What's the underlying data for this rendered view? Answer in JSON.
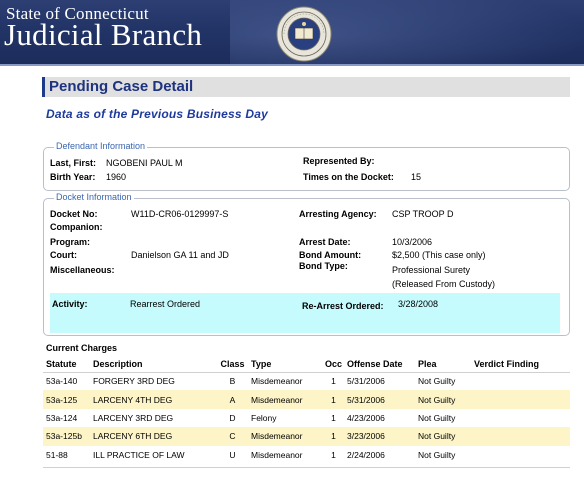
{
  "header": {
    "state": "State of Connecticut",
    "branch": "Judicial Branch",
    "seal_icon": "ct-judicial-seal-icon"
  },
  "page_title": "Pending Case Detail",
  "subtitle": "Data as of the Previous Business Day",
  "defendant": {
    "legend": "Defendant Information",
    "name_label": "Last, First:",
    "name_value": "NGOBENI PAUL M",
    "birth_label": "Birth Year:",
    "birth_value": "1960",
    "represented_label": "Represented By:",
    "represented_value": "",
    "times_label": "Times on the Docket:",
    "times_value": "15"
  },
  "docket": {
    "legend": "Docket Information",
    "docket_label": "Docket No:",
    "docket_value": "W11D-CR06-0129997-S",
    "companion_label": "Companion:",
    "program_label": "Program:",
    "court_label": "Court:",
    "court_value": "Danielson GA 11 and JD",
    "misc_label": "Miscellaneous:",
    "agency_label": "Arresting Agency:",
    "agency_value": "CSP TROOP D",
    "arrest_label": "Arrest Date:",
    "arrest_value": "10/3/2006",
    "bond_amount_label": "Bond Amount:",
    "bond_amount_value": "$2,500 (This case only)",
    "bond_type_label": "Bond Type:",
    "bond_type_value_1": "Professional Surety",
    "bond_type_value_2": "(Released From Custody)",
    "activity_label": "Activity:",
    "activity_value": "Rearrest Ordered",
    "rearrest_label": "Re-Arrest Ordered:",
    "rearrest_value": "3/28/2008"
  },
  "charges": {
    "title": "Current Charges",
    "headers": [
      "Statute",
      "Description",
      "Class",
      "Type",
      "Occ",
      "Offense Date",
      "Plea",
      "Verdict Finding"
    ],
    "rows": [
      [
        "53a-140",
        "FORGERY 3RD DEG",
        "B",
        "Misdemeanor",
        "1",
        "5/31/2006",
        "Not Guilty",
        ""
      ],
      [
        "53a-125",
        "LARCENY 4TH DEG",
        "A",
        "Misdemeanor",
        "1",
        "5/31/2006",
        "Not Guilty",
        ""
      ],
      [
        "53a-124",
        "LARCENY 3RD DEG",
        "D",
        "Felony",
        "1",
        "4/23/2006",
        "Not Guilty",
        ""
      ],
      [
        "53a-125b",
        "LARCENY 6TH DEG",
        "C",
        "Misdemeanor",
        "1",
        "3/23/2006",
        "Not Guilty",
        ""
      ],
      [
        "51-88",
        "ILL PRACTICE OF LAW",
        "U",
        "Misdemeanor",
        "1",
        "2/24/2006",
        "Not Guilty",
        ""
      ]
    ]
  },
  "colors": {
    "banner": "#223466",
    "title_text": "#1e3380",
    "activity_bg": "#c6fbfd",
    "alt_row": "#fdf5c8"
  }
}
